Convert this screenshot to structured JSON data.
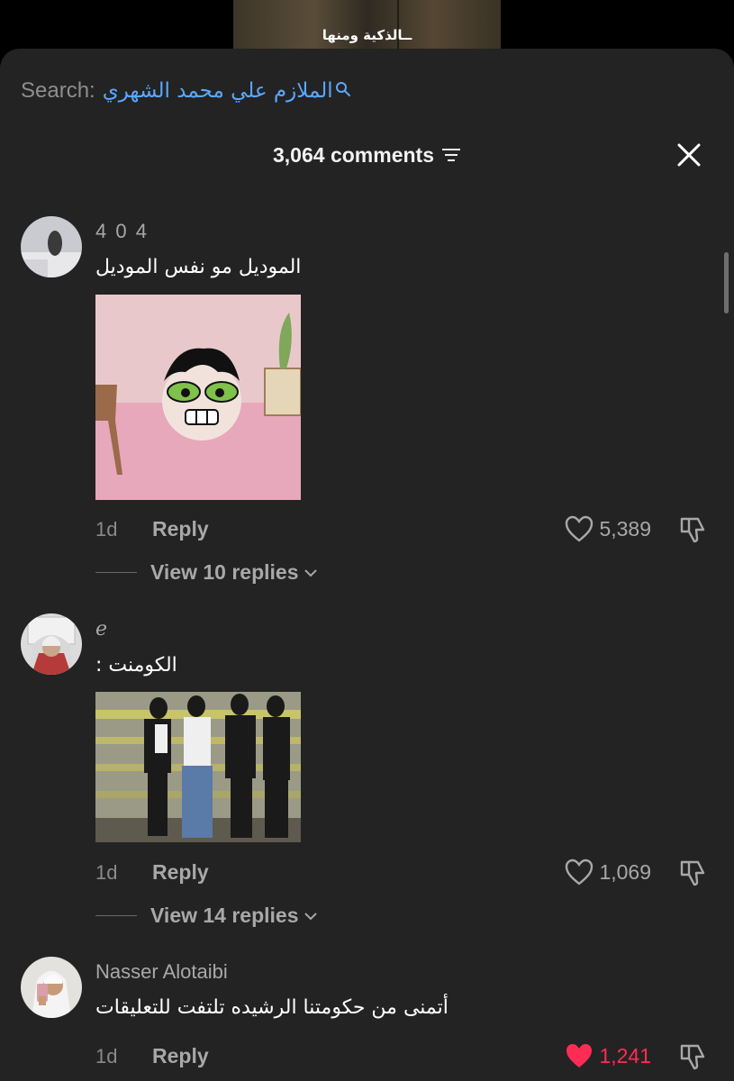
{
  "video": {
    "caption": "ــالذكية  ومنها"
  },
  "search": {
    "label": "Search:",
    "query": "الملازم علي محمد الشهري"
  },
  "header": {
    "count_label": "3,064 comments"
  },
  "comments": [
    {
      "username": "4 0 4",
      "text": "الموديل مو نفس الموديل",
      "time": "1d",
      "reply_label": "Reply",
      "likes": "5,389",
      "liked": false,
      "view_replies": "View 10 replies"
    },
    {
      "username": "e",
      "text": "الكومنت :",
      "time": "1d",
      "reply_label": "Reply",
      "likes": "1,069",
      "liked": false,
      "view_replies": "View 14 replies"
    },
    {
      "username": "Nasser Alotaibi",
      "text": "أتمنى من حكومتنا الرشيده تلتفت للتعليقات",
      "time": "1d",
      "reply_label": "Reply",
      "likes": "1,241",
      "liked": true
    }
  ],
  "colors": {
    "sheet_bg": "#232323",
    "accent_link": "#5aa8ff",
    "liked": "#fe2c55",
    "muted_text": "#a8a8a8"
  }
}
